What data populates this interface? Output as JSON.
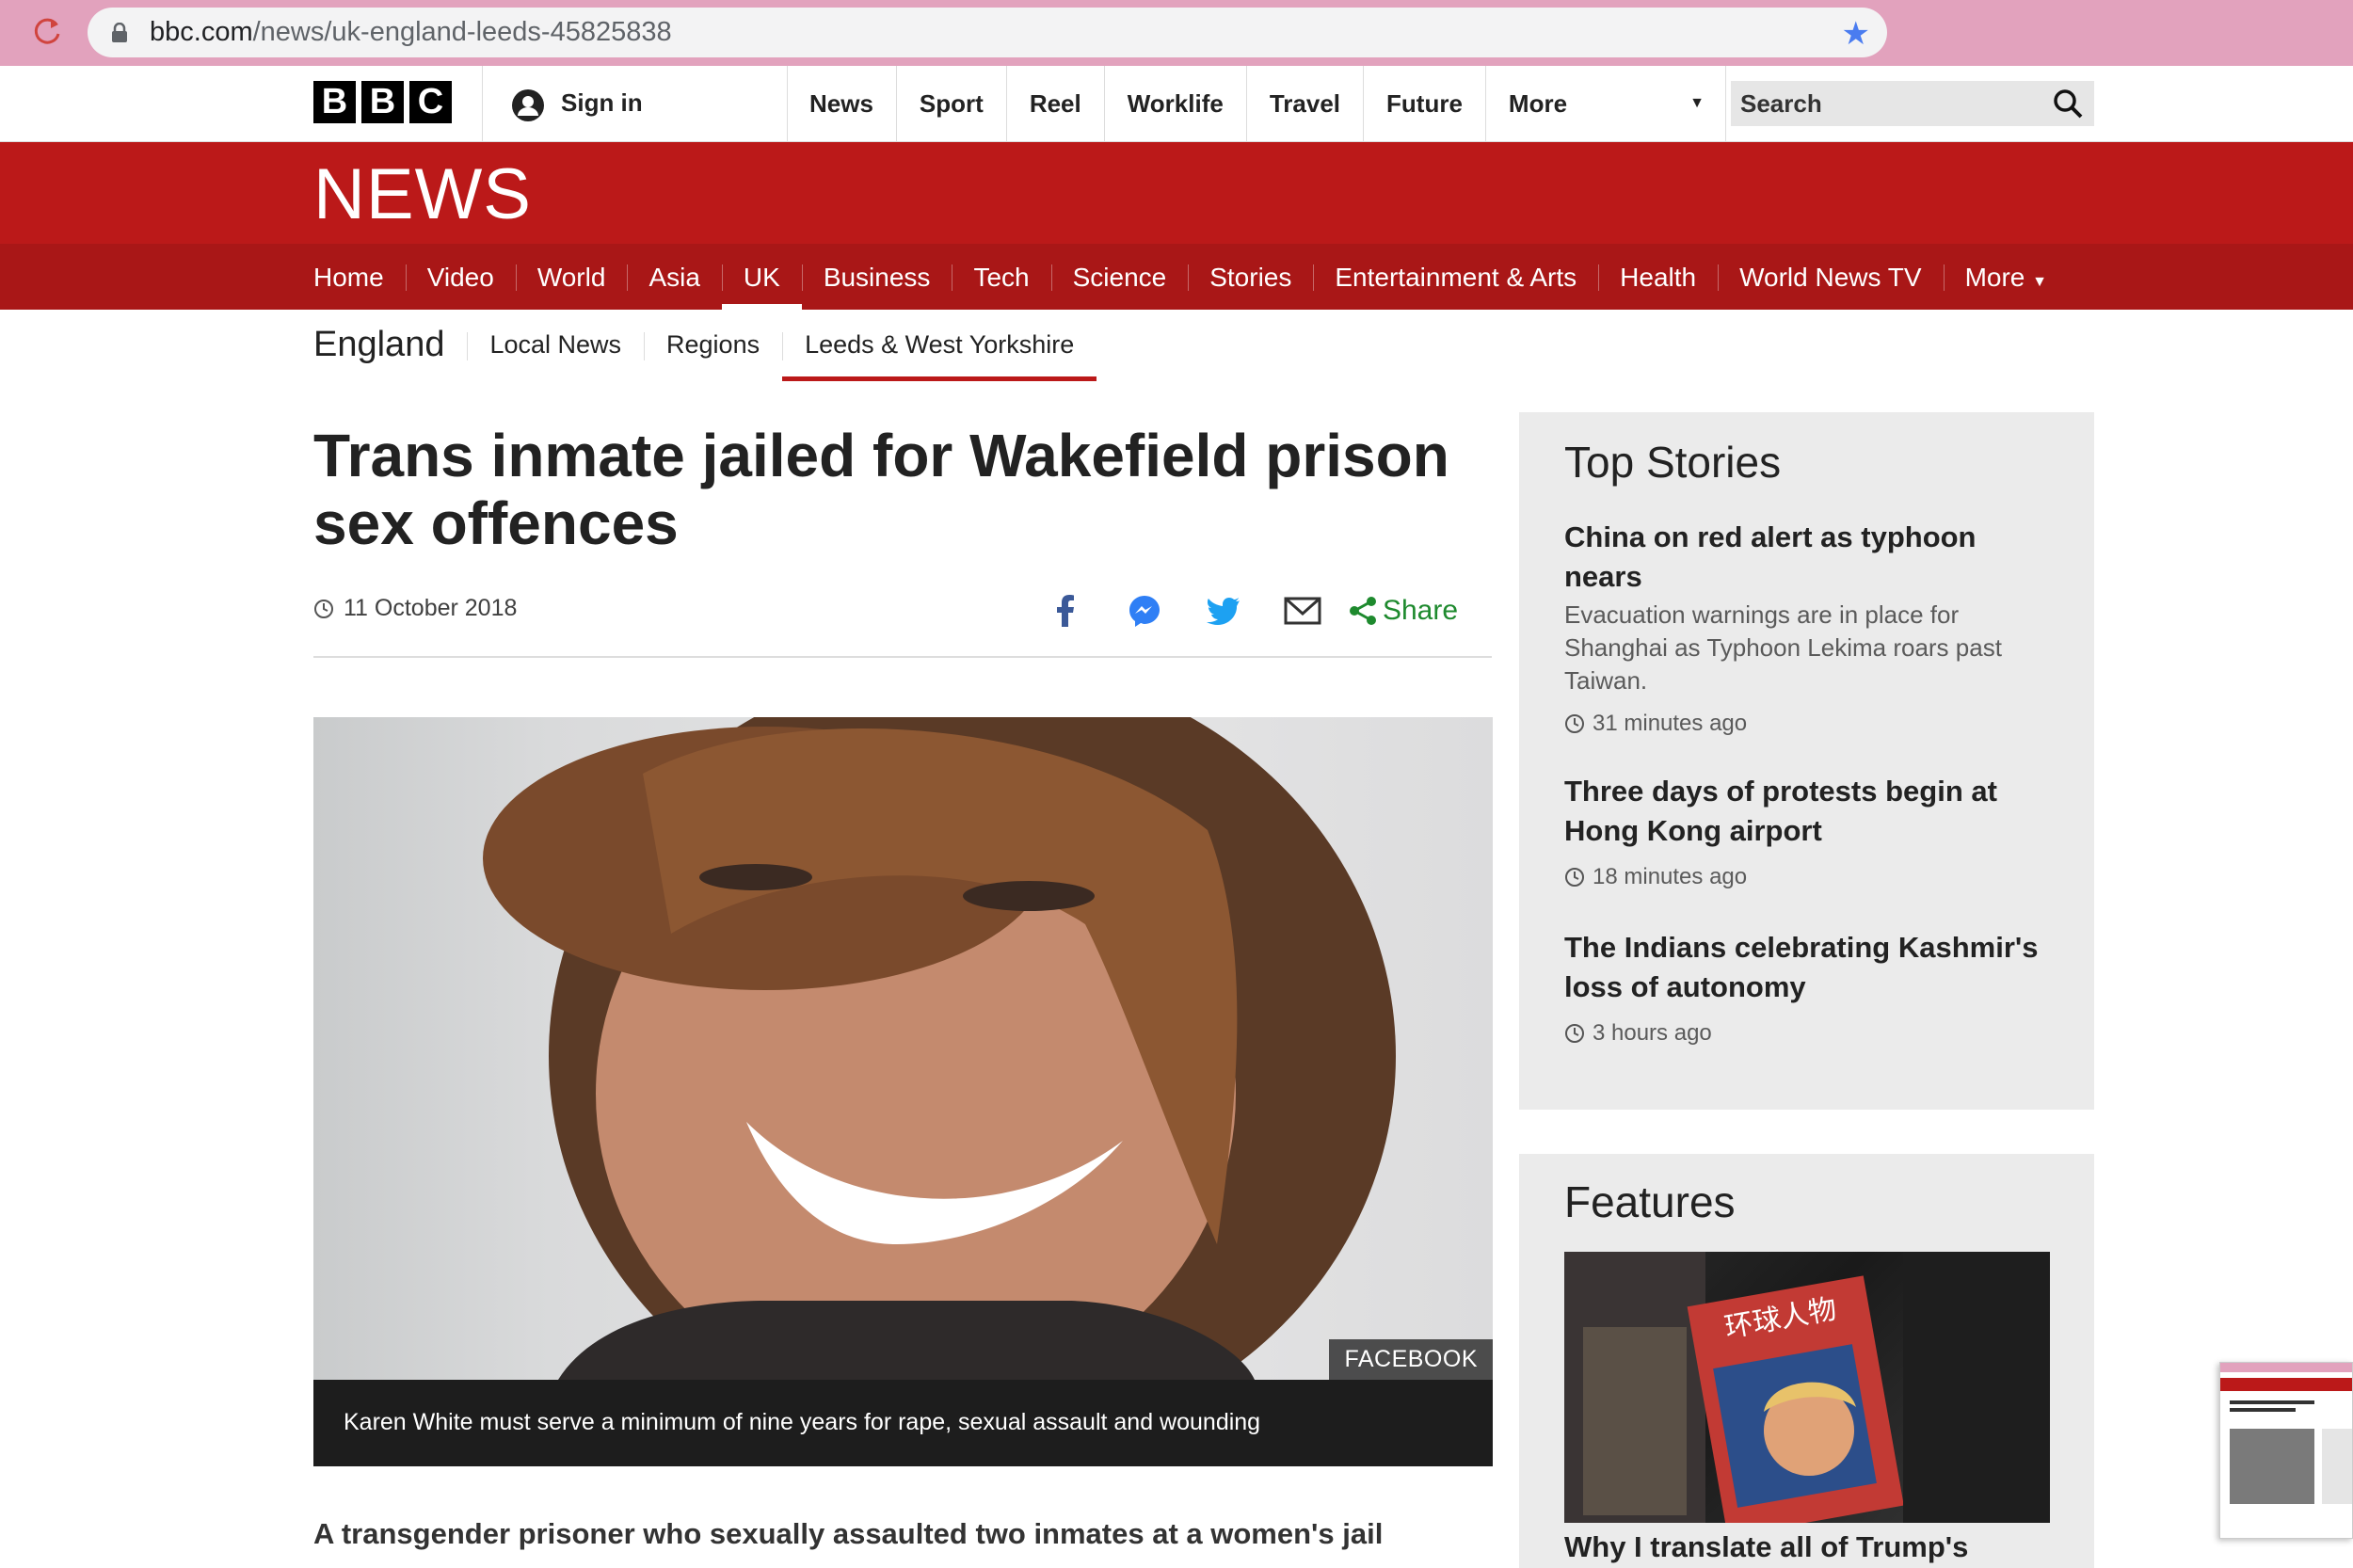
{
  "browser": {
    "url_host": "bbc.com",
    "url_path": "/news/uk-england-leeds-45825838"
  },
  "masthead": {
    "logo_letters": [
      "B",
      "B",
      "C"
    ],
    "signin_label": "Sign in",
    "nav": [
      "News",
      "Sport",
      "Reel",
      "Worklife",
      "Travel",
      "Future"
    ],
    "more_label": "More",
    "search_label": "Search"
  },
  "news": {
    "wordmark": "NEWS",
    "nav": [
      "Home",
      "Video",
      "World",
      "Asia",
      "UK",
      "Business",
      "Tech",
      "Science",
      "Stories",
      "Entertainment & Arts",
      "Health",
      "World News TV"
    ],
    "nav_active": "UK",
    "nav_more": "More"
  },
  "section": {
    "title": "England",
    "items": [
      "Local News",
      "Regions",
      "Leeds & West Yorkshire"
    ],
    "active": "Leeds & West Yorkshire"
  },
  "article": {
    "headline": "Trans inmate jailed for Wakefield prison sex offences",
    "date": "11 October 2018",
    "share_label": "Share",
    "share_icons": [
      "facebook-icon",
      "messenger-icon",
      "twitter-icon",
      "email-icon",
      "share-icon"
    ],
    "photo_credit": "FACEBOOK",
    "caption": "Karen White must serve a minimum of nine years for rape, sexual assault and wounding",
    "lede": "A transgender prisoner who sexually assaulted two inmates at a women's jail"
  },
  "top_stories": {
    "title": "Top Stories",
    "items": [
      {
        "title": "China on red alert as typhoon nears",
        "summary": "Evacuation warnings are in place for Shanghai as Typhoon Lekima roars past Taiwan.",
        "time": "31 minutes ago"
      },
      {
        "title": "Three days of protests begin at Hong Kong airport",
        "summary": "",
        "time": "18 minutes ago"
      },
      {
        "title": "The Indians celebrating Kashmir's loss of autonomy",
        "summary": "",
        "time": "3 hours ago"
      }
    ]
  },
  "features": {
    "title": "Features",
    "item_title": "Why I translate all of Trump's",
    "image_text": "环球人物"
  },
  "colors": {
    "bbc_red": "#bb1919",
    "nav_red": "#a91717",
    "share_green": "#1e8a2e",
    "browser_bar": "#e2a2bd"
  }
}
